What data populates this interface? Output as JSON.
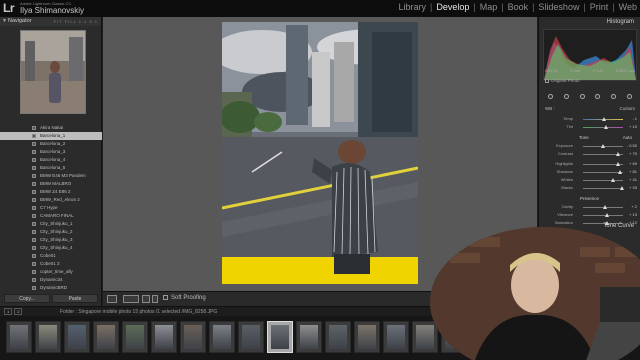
{
  "app": {
    "logo": "Lr",
    "subtitle": "Adobe Lightroom Classic CC",
    "user": "Ilya Shimanovskiy"
  },
  "modules": [
    "Library",
    "Develop",
    "Map",
    "Book",
    "Slideshow",
    "Print",
    "Web"
  ],
  "active_module": "Develop",
  "left_panel": {
    "navigator_title": "Navigator",
    "navigator_options": "FIT FILL 1:1 3:1",
    "presets": [
      "Akira Nakai",
      "Barcelona_1",
      "Barcelona_2",
      "Barcelona_3",
      "Barcelona_4",
      "Barcelona_5",
      "BMW E46 M3 Pandem",
      "BMW MALBRO",
      "BMW Z4 E86 2",
      "BMW_Red_Akron 2",
      "C7 Hype",
      "CAMARO FINAL",
      "City_Shinjuku_1",
      "City_Shinjuku_2",
      "City_Shinjuku_3",
      "City_Shinjuku_4",
      "Cobe01",
      "Cobe01 2",
      "copter_time_ally",
      "Dynamic34",
      "DynamicBRD"
    ],
    "selected_preset_index": 1,
    "copy_label": "Copy...",
    "paste_label": "Paste"
  },
  "toolbar": {
    "soft_proofing_label": "Soft Proofing"
  },
  "right_panel": {
    "histogram_title": "Histogram",
    "exif": [
      "ISO 20",
      "4 mm",
      "f / 1.8",
      "1/4000 sec"
    ],
    "original_photo_label": "Original Photo",
    "wb_label": "WB :",
    "wb_value": "Custom",
    "temp": {
      "label": "Temp",
      "value": "- 1"
    },
    "tint": {
      "label": "Tint",
      "value": "+ 10"
    },
    "tone_label": "Tone",
    "tone_auto": "Auto",
    "exposure": {
      "label": "Exposure",
      "value": "- 0.50"
    },
    "contrast": {
      "label": "Contrast",
      "value": "+ 70"
    },
    "highlights": {
      "label": "Highlights",
      "value": "+ 69"
    },
    "shadows": {
      "label": "Shadows",
      "value": "+ 81"
    },
    "whites": {
      "label": "Whites",
      "value": "+ 41"
    },
    "blacks": {
      "label": "Blacks",
      "value": "+ 93"
    },
    "presence_label": "Presence",
    "clarity": {
      "label": "Clarity",
      "value": "+ 2"
    },
    "vibrance": {
      "label": "Vibrance",
      "value": "+ 13"
    },
    "saturation": {
      "label": "Saturation",
      "value": "+ 12"
    },
    "tone_curve_label": "Tone Curve"
  },
  "filmstrip": {
    "page_buttons": [
      "1",
      "2"
    ],
    "info": "Folder : Singapore mobile photo      15 photos /1 selected /IMG_8258.JPG",
    "selected_index": 9,
    "thumb_count": 17
  },
  "colors": {
    "accent_yellow": "#f0d400",
    "panel_bg": "#2b2b2b",
    "center_bg": "#585858"
  }
}
